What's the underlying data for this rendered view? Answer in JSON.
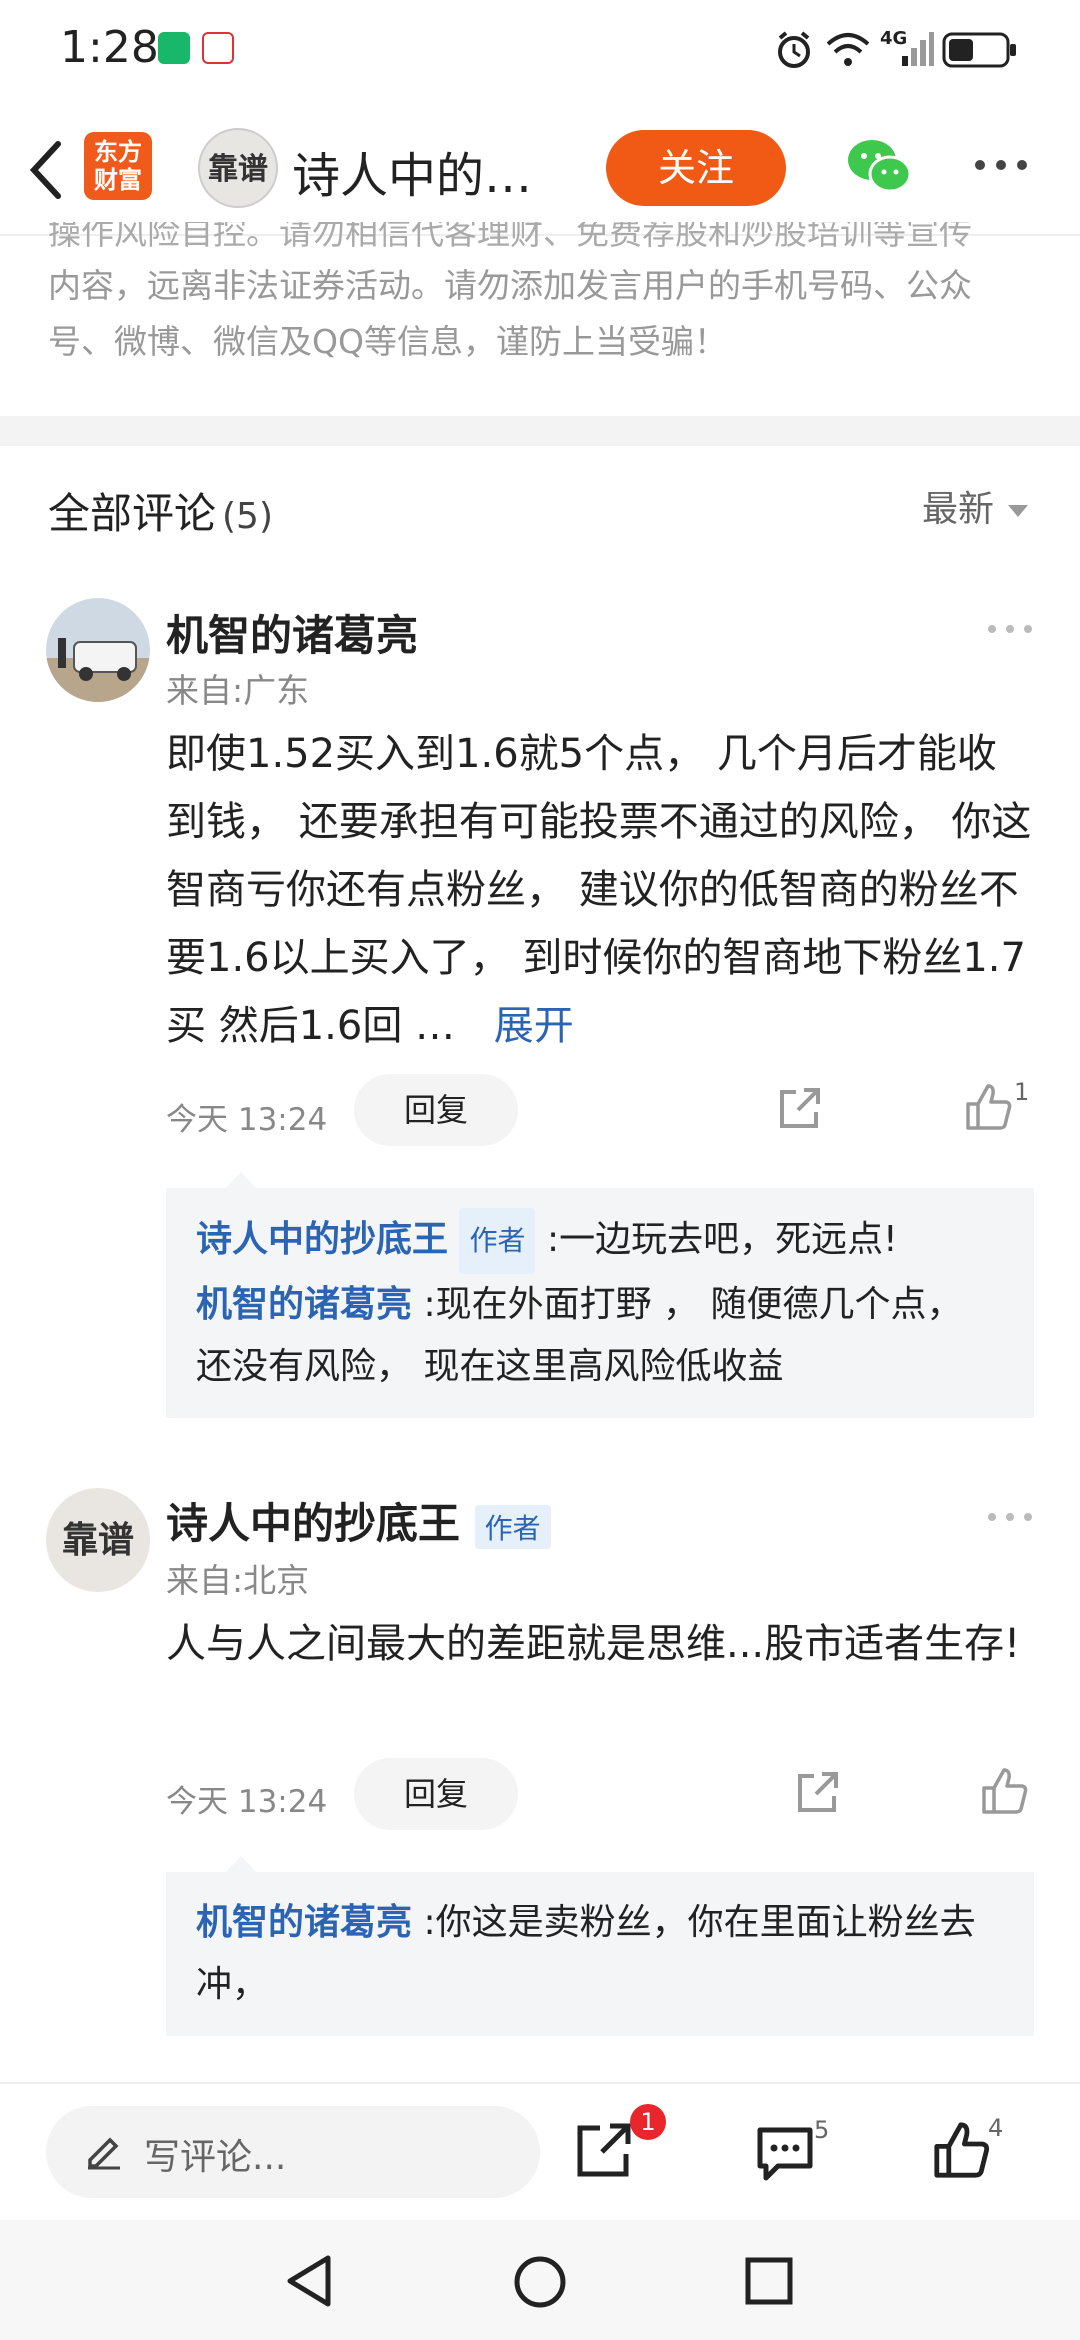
{
  "status_bar": {
    "time": "1:28",
    "network": "4G"
  },
  "nav": {
    "brand_logo_text": [
      "东方",
      "财富"
    ],
    "avatar_text": "靠谱",
    "title": "诗人中的…",
    "follow_label": "关注"
  },
  "disclaimer": {
    "line1": "操作风险自控。请勿相信代客理财、免费荐股和炒股培训等宣传",
    "line2": "内容，远离非法证券活动。请勿添加发言用户的手机号码、公众",
    "line3": "号、微博、微信及QQ等信息，谨防上当受骗！"
  },
  "comments_header": {
    "title": "全部评论",
    "count": "(5)",
    "sort_label": "最新"
  },
  "comments": [
    {
      "user": "机智的诸葛亮",
      "location": "来自:广东",
      "text": "即使1.52买入到1.6就5个点， 几个月后才能收到钱， 还要承担有可能投票不通过的风险， 你这智商亏你还有点粉丝， 建议你的低智商的粉丝不要1.6以上买入了，  到时候你的智商地下粉丝1.7买 然后1.6回 …",
      "expand_label": "展开",
      "time": "今天 13:24",
      "reply_label": "回复",
      "like_count": "1",
      "replies": [
        {
          "name": "诗人中的抄底王",
          "tag": "作者",
          "text": ":一边玩去吧，死远点!"
        },
        {
          "name": "机智的诸葛亮",
          "tag": "",
          "text": ":现在外面打野 ，  随便德几个点， 还没有风险， 现在这里高风险低收益"
        }
      ]
    },
    {
      "user": "诗人中的抄底王",
      "author_tag": "作者",
      "location": "来自:北京",
      "text": "人与人之间最大的差距就是思维...股市适者生存!",
      "time": "今天 13:24",
      "reply_label": "回复",
      "like_count": "",
      "replies": [
        {
          "name": "机智的诸葛亮",
          "tag": "",
          "text": ":你这是卖粉丝，你在里面让粉丝去冲，"
        }
      ]
    }
  ],
  "bottom_bar": {
    "input_placeholder": "写评论...",
    "share_badge": "1",
    "comment_count": "5",
    "like_count": "4"
  },
  "colors": {
    "accent_orange": "#f05a14",
    "link_blue": "#2c64b4",
    "wechat_green": "#3ec84e",
    "badge_red": "#e8262b"
  }
}
